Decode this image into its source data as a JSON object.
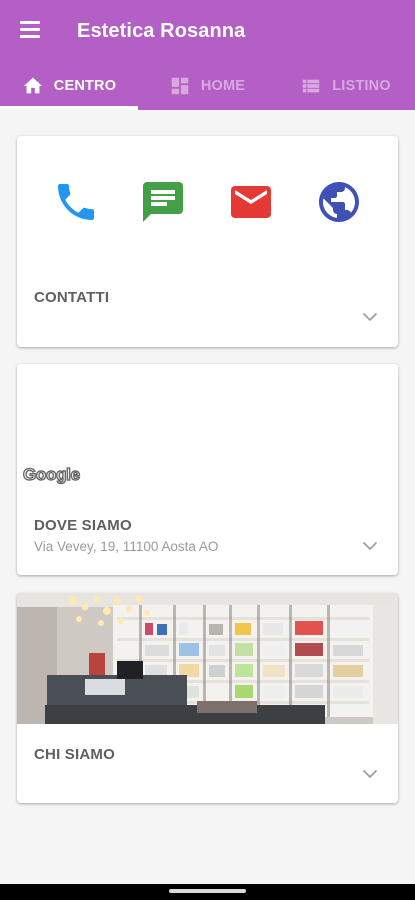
{
  "app": {
    "title": "Estetica Rosanna",
    "accent_color": "#b45fc6"
  },
  "tabs": [
    {
      "label": "CENTRO",
      "icon": "home-icon",
      "active": true
    },
    {
      "label": "HOME",
      "icon": "dashboard-icon",
      "active": false
    },
    {
      "label": "LISTINO",
      "icon": "list-icon",
      "active": false
    }
  ],
  "cards": {
    "contacts": {
      "title": "CONTATTI",
      "icons": [
        "phone-icon",
        "message-icon",
        "email-icon",
        "globe-icon"
      ],
      "icon_colors": [
        "#2196f3",
        "#43a047",
        "#e53935",
        "#3f51b5"
      ]
    },
    "location": {
      "title": "DOVE SIAMO",
      "address": "Via Vevey, 19, 11100 Aosta AO",
      "map_logo": "Google"
    },
    "about": {
      "title": "CHI SIAMO"
    }
  }
}
